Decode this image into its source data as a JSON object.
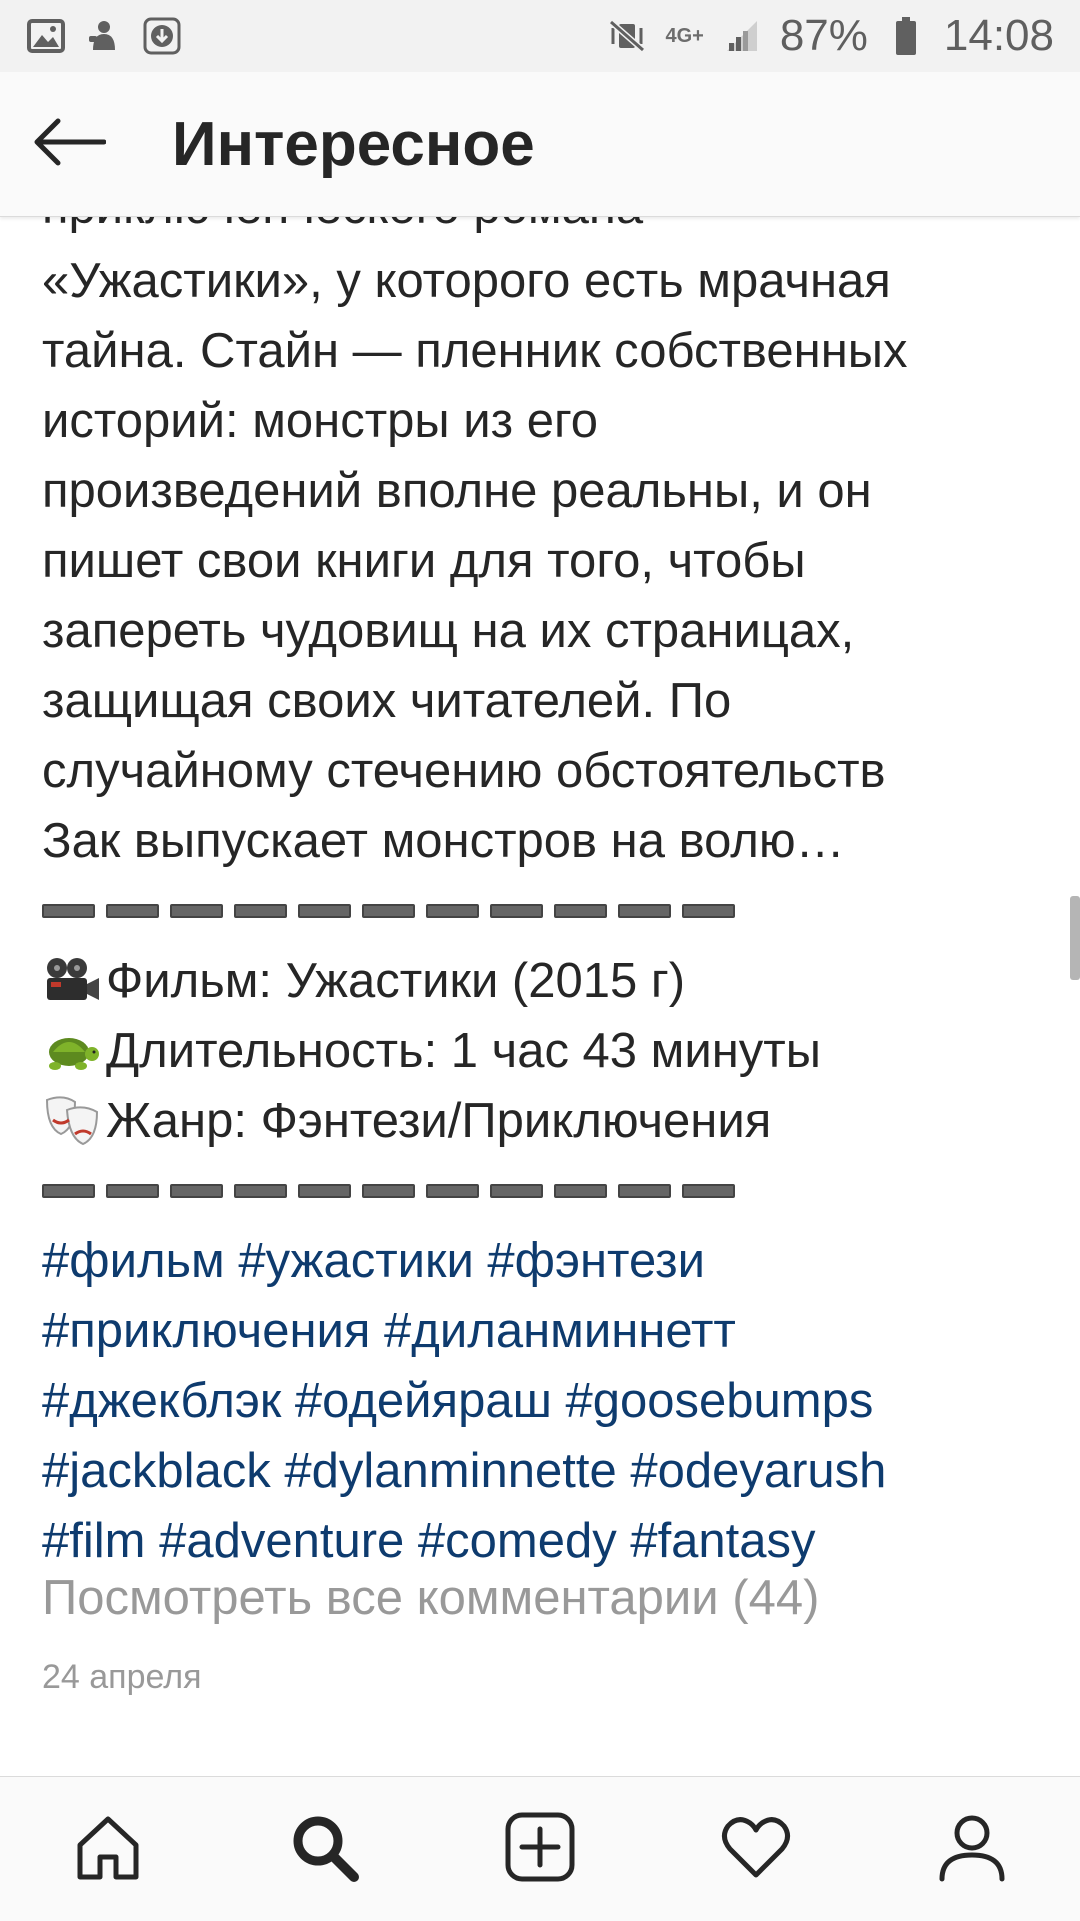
{
  "status_bar": {
    "network": "4G+",
    "battery": "87%",
    "time": "14:08"
  },
  "header": {
    "title": "Интересное"
  },
  "post": {
    "cut_line": "приключенческого романа",
    "lines": [
      "«Ужастики», у которого есть мрачная",
      "тайна. Стайн — пленник собственных",
      "историй: монстры из его",
      "произведений вполне реальны, и он",
      "пишет свои книги для того, чтобы",
      "запереть чудовищ на их страницах,",
      "защищая своих читателей. По",
      "случайному стечению обстоятельств",
      "Зак выпускает монстров на волю…"
    ],
    "info": {
      "film": "Фильм: Ужастики (2015 г)",
      "duration": "Длительность: 1 час 43 минуты",
      "genre": "Жанр: Фэнтези/Приключения"
    },
    "hashtag_lines": [
      "#фильм #ужастики #фэнтези",
      "#приключения #диланминнетт",
      "#джекблэк #одейяраш #goosebumps",
      "#jackblack #dylanminnette #odeyarush",
      "#film #adventure #comedy #fantasy"
    ],
    "comments_link": "Посмотреть все комментарии (44)",
    "date": "24 апреля"
  },
  "nav": {
    "items": [
      "home-icon",
      "search-icon",
      "add-post-icon",
      "activity-heart-icon",
      "profile-icon"
    ]
  },
  "colors": {
    "hashtag": "#0e3b6e",
    "muted": "#999999",
    "text": "#262626"
  }
}
